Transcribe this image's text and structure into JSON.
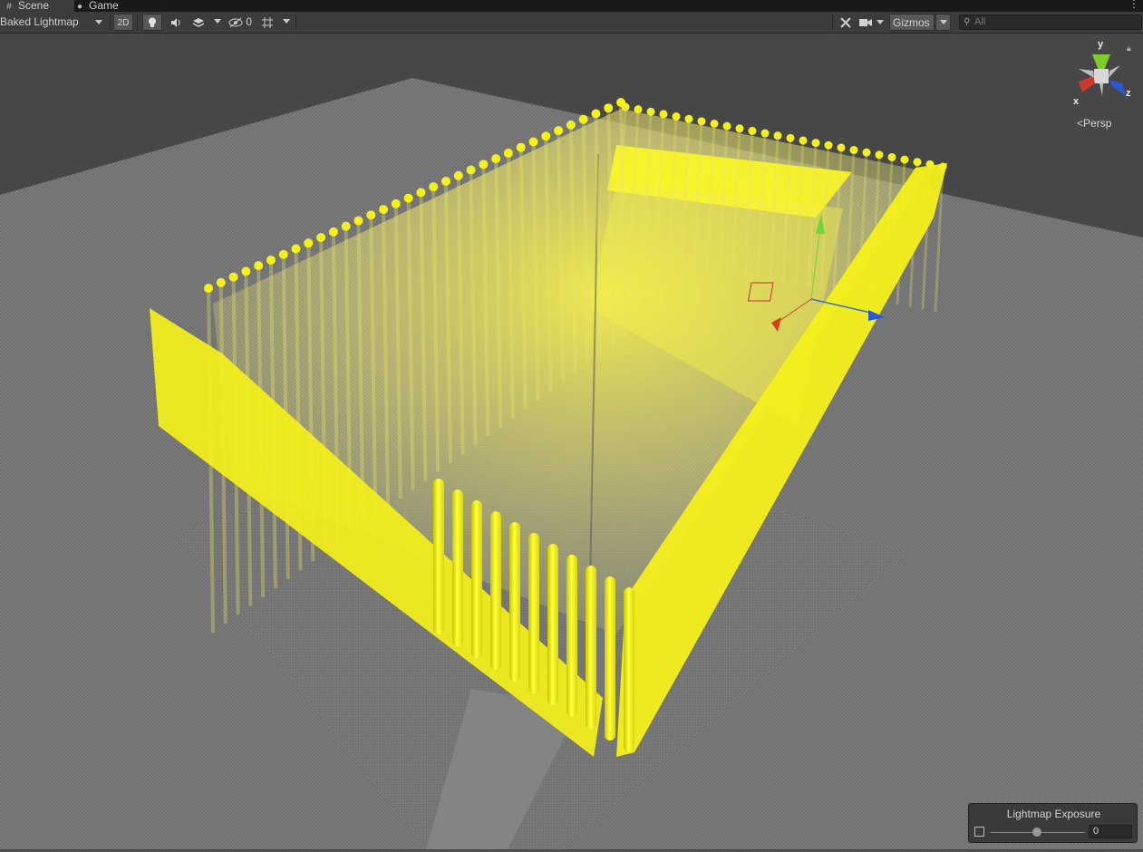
{
  "tabs": [
    {
      "label": "Scene",
      "icon": "grid-icon",
      "active": true
    },
    {
      "label": "Game",
      "icon": "gamepad-icon",
      "active": false
    }
  ],
  "toolbar": {
    "draw_mode": "Baked Lightmap",
    "toggle_2d": "2D",
    "hidden_count": "0",
    "gizmos_label": "Gizmos",
    "search_placeholder": "All"
  },
  "orientation_gizmo": {
    "axes": {
      "y": "y",
      "x": "x",
      "z": "z"
    },
    "projection": "Persp",
    "colors": {
      "x": "#c93a2a",
      "y": "#7ccb2a",
      "z": "#2a56d8"
    }
  },
  "lightmap_overlay": {
    "title": "Lightmap Exposure",
    "value": "0",
    "slider_fraction": 0.5
  },
  "colors": {
    "probe": "#f2f216",
    "background": "#4d4d4d",
    "toolbar": "#3c3c3c"
  }
}
